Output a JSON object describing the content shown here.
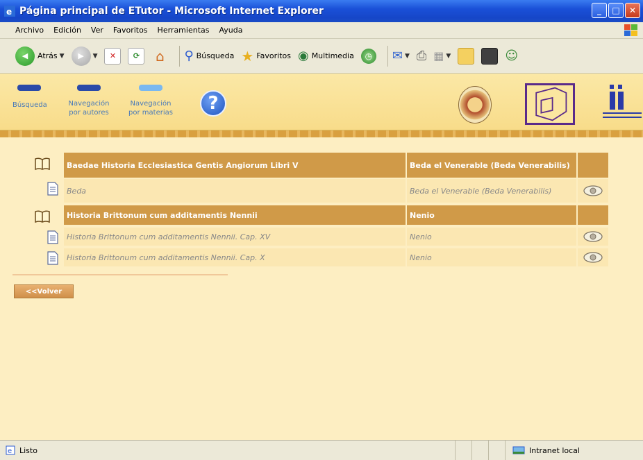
{
  "window": {
    "title": "Página principal de ETutor - Microsoft Internet Explorer",
    "minimize": "_",
    "maximize": "□",
    "close": "✕"
  },
  "menu": [
    "Archivo",
    "Edición",
    "Ver",
    "Favoritos",
    "Herramientas",
    "Ayuda"
  ],
  "toolbar": {
    "back": "Atrás",
    "search": "Búsqueda",
    "favorites": "Favoritos",
    "multimedia": "Multimedia"
  },
  "nav": {
    "search": "Búsqueda",
    "authors_line1": "Navegación",
    "authors_line2": "por autores",
    "subjects_line1": "Navegación",
    "subjects_line2": "por materias",
    "help_glyph": "?"
  },
  "colors": {
    "header_bg": "#d09a48",
    "row_bg": "#fbe7b2",
    "page_bg": "#fdeec2"
  },
  "works": [
    {
      "title": "Baedae Historia Ecclesiastica Gentis Angiorum Libri V",
      "author": "Beda el Venerable (Beda Venerabilis)",
      "docs": [
        {
          "title": "Beda",
          "author": "Beda el Venerable (Beda Venerabilis)"
        }
      ]
    },
    {
      "title": "Historia Brittonum cum additamentis Nennii",
      "author": "Nenio",
      "docs": [
        {
          "title": "Historia Brittonum cum additamentis Nennii. Cap. XV",
          "author": "Nenio"
        },
        {
          "title": "Historia Brittonum cum additamentis Nennii. Cap. X",
          "author": "Nenio"
        }
      ]
    }
  ],
  "buttons": {
    "volver": "<<Volver"
  },
  "status": {
    "left": "Listo",
    "zone": "Intranet local"
  }
}
